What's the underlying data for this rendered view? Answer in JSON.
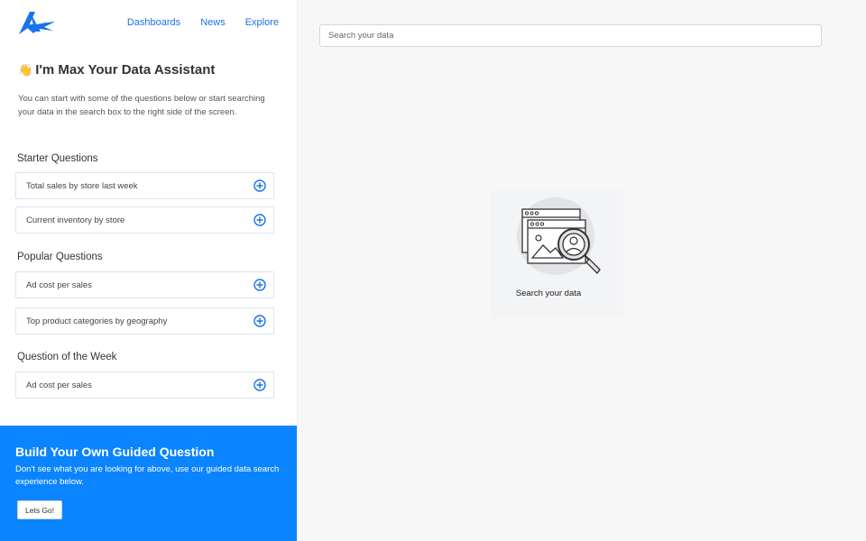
{
  "nav": {
    "links": [
      "Dashboards",
      "News",
      "Explore"
    ],
    "accent_color": "#1a73e8"
  },
  "assistant": {
    "emoji": "👋",
    "title": "I'm Max Your Data Assistant",
    "intro": "You can start with some of the questions below or start searching your data in the search box to the right side of the screen."
  },
  "sections": {
    "starter": {
      "heading": "Starter Questions",
      "items": [
        "Total sales by store last week",
        "Current inventory by store"
      ]
    },
    "popular": {
      "heading": "Popular Questions",
      "items": [
        "Ad cost per sales",
        "Top product categories by geography"
      ]
    },
    "weekly": {
      "heading": "Question of the Week",
      "items": [
        "Ad cost per sales"
      ]
    },
    "item_icon": "plus-circle-icon"
  },
  "cta": {
    "title": "Build Your Own Guided Question",
    "body": "Don't see what you are looking for above, use our guided data search experience below.",
    "button": "Lets Go!",
    "background": "#0a84ff"
  },
  "search": {
    "placeholder": "Search your data"
  },
  "empty_state": {
    "icon": "search-data-illustration",
    "label": "Search your data"
  }
}
